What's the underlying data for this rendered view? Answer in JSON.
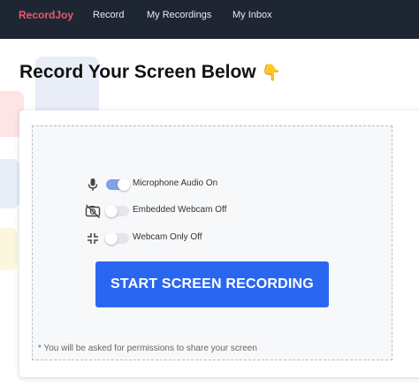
{
  "navbar": {
    "brand": "RecordJoy",
    "links": [
      "Record",
      "My Recordings",
      "My Inbox"
    ]
  },
  "page": {
    "title": "Record Your Screen Below",
    "title_emoji": "👇"
  },
  "options": [
    {
      "icon": "microphone-icon",
      "label": "Microphone Audio On",
      "enabled": true
    },
    {
      "icon": "webcam-off-icon",
      "label": "Embedded Webcam Off",
      "enabled": false
    },
    {
      "icon": "minimize-icon",
      "label": "Webcam Only Off",
      "enabled": false
    }
  ],
  "start_button": {
    "label": "START SCREEN RECORDING"
  },
  "note": "* You will be asked for permissions to share your screen",
  "colors": {
    "navbar_bg": "#1f2633",
    "brand": "#f0576a",
    "button": "#2a67f0",
    "toggle_on": "#7fa2ea"
  }
}
